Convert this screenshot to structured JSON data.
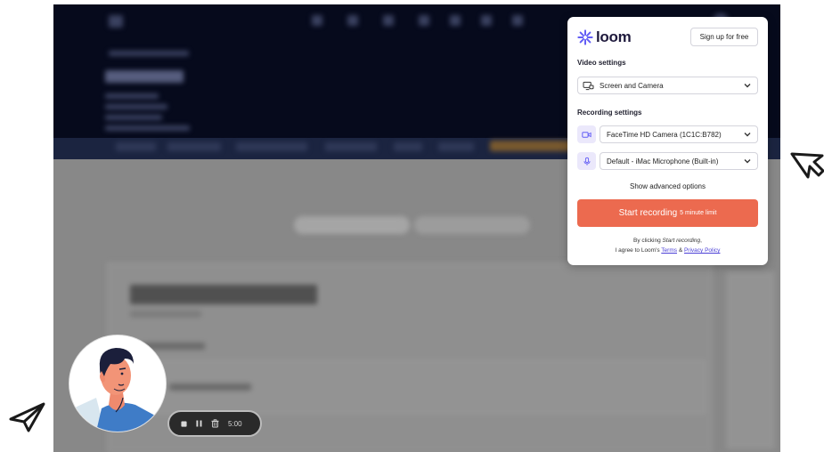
{
  "loom": {
    "logo_text": "loom",
    "signup_label": "Sign up for free",
    "video_settings_label": "Video settings",
    "video_source": "Screen and Camera",
    "recording_settings_label": "Recording settings",
    "camera": "FaceTime HD Camera (1C1C:B782)",
    "microphone": "Default - iMac Microphone (Built-in)",
    "advanced_label": "Show advanced options",
    "start_label": "Start recording",
    "start_limit": "5 minute limit",
    "legal_line1_prefix": "By clicking",
    "legal_line1_em": "Start recording",
    "legal_line1_suffix": ",",
    "legal_line2_prefix": "I agree to Loom's",
    "terms_label": "Terms",
    "amp": "&",
    "privacy_label": "Privacy Policy"
  },
  "recorder": {
    "timer": "5:00"
  },
  "colors": {
    "brand": "#625df5",
    "start_button": "#ec6a4f",
    "panel_bg": "#ffffff",
    "controls_bg": "#2a2a2a"
  },
  "icons": [
    "loom-logo-icon",
    "monitor-camera-icon",
    "chevron-down-icon",
    "camera-icon",
    "microphone-icon",
    "stop-icon",
    "pause-icon",
    "trash-icon",
    "paper-plane-icon",
    "cursor-arrow-icon"
  ]
}
